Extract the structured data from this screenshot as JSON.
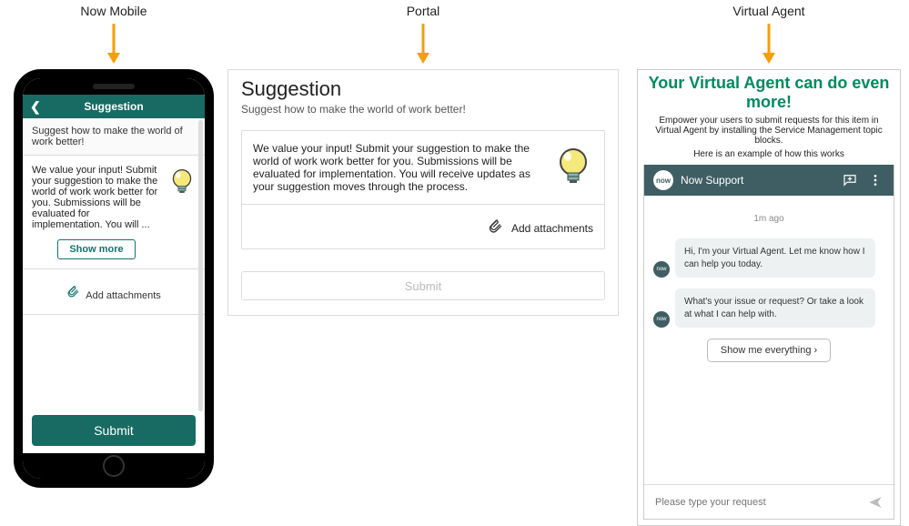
{
  "labels": {
    "mobile": "Now Mobile",
    "portal": "Portal",
    "va": "Virtual Agent"
  },
  "colors": {
    "teal": "#0f766e",
    "arrow": "#f59e0b",
    "va_title": "#008b5c"
  },
  "mobile": {
    "header": "Suggestion",
    "back_icon": "chevron-left",
    "subtitle": "Suggest how to make the world of work better!",
    "description": "We value your input! Submit your suggestion to make the world of work work better for you. Submissions will be evaluated for implementation. You will ...",
    "show_more": "Show more",
    "attach": "Add attachments",
    "submit": "Submit"
  },
  "portal": {
    "title": "Suggestion",
    "subtitle": "Suggest how to make the world of work better!",
    "description": "We value your input! Submit your suggestion to make the world of work work better for you. Submissions will be evaluated for implementation. You will receive updates as your suggestion moves through the process.",
    "attach": "Add attachments",
    "submit": "Submit"
  },
  "va": {
    "title": "Your Virtual Agent can do even more!",
    "subtitle": "Empower your users to submit requests for this item in Virtual Agent by installing the Service Management topic blocks.",
    "example_caption": "Here is an example of how this works",
    "chat": {
      "brand_badge": "now",
      "header_title": "Now Support",
      "header_icons": [
        "new-chat-icon",
        "more-icon"
      ],
      "timestamp": "1m ago",
      "messages": [
        "Hi, I'm your Virtual Agent. Let me know how I can help you today.",
        "What's your issue or request? Or take a look at what I can help with."
      ],
      "show_everything": "Show me everything",
      "input_placeholder": "Please type your request"
    }
  }
}
